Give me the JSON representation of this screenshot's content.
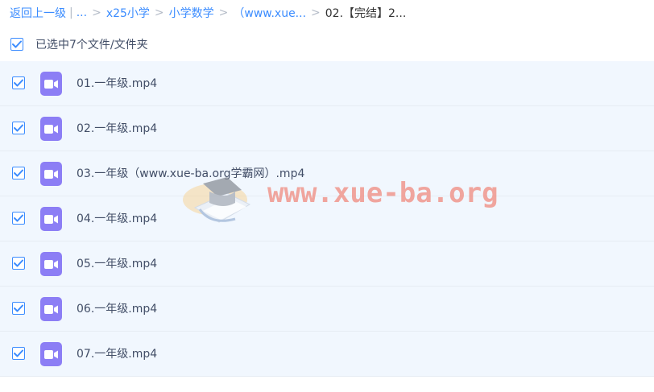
{
  "breadcrumb": {
    "back": "返回上一级",
    "divider": "|",
    "ellipsis": "...",
    "items": [
      "x25小学",
      "小学数学",
      "（www.xue...",
      "02.【完结】2..."
    ],
    "separator": ">"
  },
  "selection": {
    "label": "已选中7个文件/文件夹",
    "checked": true
  },
  "files": [
    {
      "name": "01.一年级.mp4",
      "checked": true
    },
    {
      "name": "02.一年级.mp4",
      "checked": true
    },
    {
      "name": "03.一年级（www.xue-ba.org学霸网）.mp4",
      "checked": true
    },
    {
      "name": "04.一年级.mp4",
      "checked": true
    },
    {
      "name": "05.一年级.mp4",
      "checked": true
    },
    {
      "name": "06.一年级.mp4",
      "checked": true
    },
    {
      "name": "07.一年级.mp4",
      "checked": true
    }
  ],
  "watermark": {
    "text": "www.xue-ba.org"
  },
  "colors": {
    "accent": "#3b8cff",
    "row_bg": "#f1f7fe",
    "video_icon": "#8c7ef5",
    "watermark": "#f08a7e"
  },
  "icons": {
    "file": "video-file-icon",
    "check": "checkmark-icon"
  }
}
